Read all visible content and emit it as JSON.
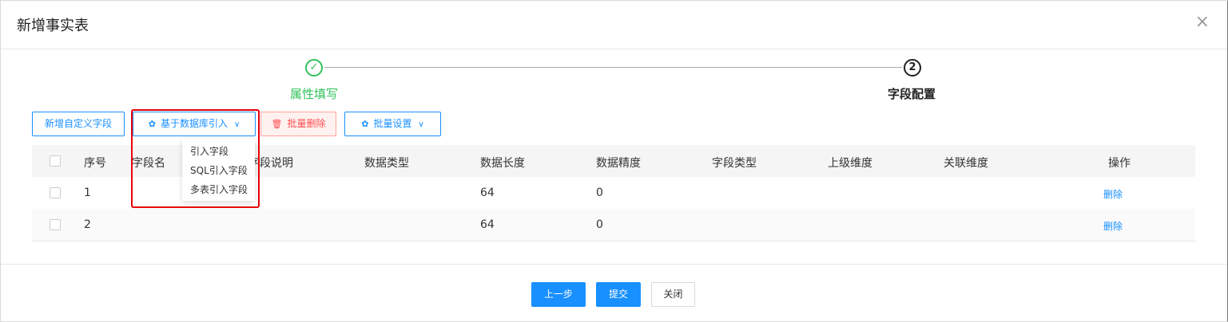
{
  "dialog": {
    "title": "新增事实表",
    "close_glyph": "×"
  },
  "steps": [
    {
      "icon": "✓",
      "label": "属性填写",
      "status": "finished"
    },
    {
      "icon": "2",
      "label": "字段配置",
      "status": "current"
    }
  ],
  "toolbar": {
    "add_custom_field": "新增自定义字段",
    "import_from_db": "基于数据库引入",
    "batch_delete": "批量删除",
    "batch_settings": "批量设置"
  },
  "import_menu": [
    "引入字段",
    "SQL引入字段",
    "多表引入字段"
  ],
  "table": {
    "headers": [
      "序号",
      "字段名",
      "字段说明",
      "数据类型",
      "数据长度",
      "数据精度",
      "字段类型",
      "上级维度",
      "关联维度",
      "操作"
    ],
    "rows": [
      {
        "index": "1",
        "field_name": "",
        "field_desc": "",
        "data_type": "",
        "length": "64",
        "precision": "0",
        "field_type": "",
        "parent_dim": "",
        "related_dim": "",
        "action": "删除"
      },
      {
        "index": "2",
        "field_name": "",
        "field_desc": "",
        "data_type": "",
        "length": "64",
        "precision": "0",
        "field_type": "",
        "parent_dim": "",
        "related_dim": "",
        "action": "删除"
      }
    ]
  },
  "footer": {
    "prev": "上一步",
    "submit": "提交",
    "close": "关闭"
  },
  "colors": {
    "primary": "#1890ff",
    "success": "#2fc25b",
    "danger": "#ff4d4f",
    "highlight_box": "#e8000b"
  },
  "icons": {
    "gear": "gear-icon",
    "trash": "trash-icon",
    "caret": "chevron-down-icon",
    "check": "check-icon",
    "close": "close-icon"
  }
}
